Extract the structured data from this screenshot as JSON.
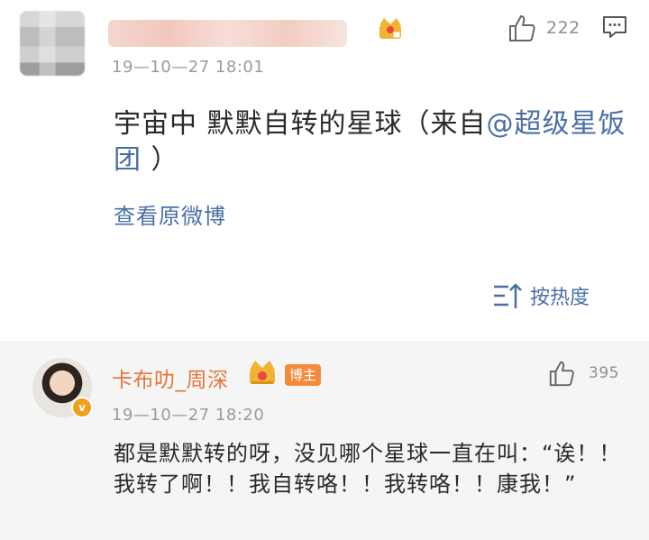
{
  "post": {
    "like_count": "222",
    "timestamp": "19—10—27 18:01",
    "text_before": "宇宙中 默默自转的星球（来自",
    "mention": "@超级星饭团",
    "text_after": " ）",
    "view_original": "查看原微博",
    "sort_label": "按热度",
    "icons": [
      "crown-icon",
      "thumbs-up-icon",
      "comment-icon",
      "sort-icon"
    ]
  },
  "reply": {
    "username": "卡布叻_周深",
    "badge": "博主",
    "like_count": "395",
    "timestamp": "19—10—27 18:20",
    "text": "都是默默转的呀，没见哪个星球一直在叫：“诶！！我转了啊！！我自转咯！！我转咯！！康我！”",
    "verified_mark": "v",
    "icons": [
      "crown-icon",
      "thumbs-up-icon",
      "verified-icon"
    ]
  },
  "colors": {
    "link": "#4a6fa5",
    "username": "#e5753b",
    "badge_bg": "#f58a3a",
    "crown": "#f2b233"
  }
}
